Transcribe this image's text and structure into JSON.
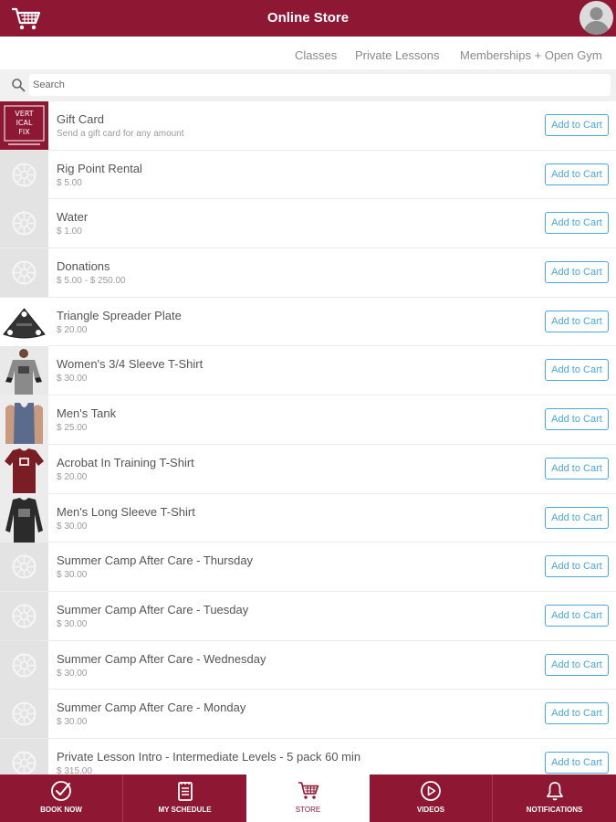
{
  "header": {
    "title": "Online Store",
    "cart_icon": "shopping-cart-icon",
    "avatar_icon": "user-avatar-icon",
    "brand_color": "#8e1734"
  },
  "tabs": [
    {
      "label": "Classes"
    },
    {
      "label": "Private Lessons"
    },
    {
      "label": "Memberships + Open Gym"
    }
  ],
  "search": {
    "placeholder": "Search"
  },
  "button_label": "Add to Cart",
  "products": [
    {
      "name": "Gift Card",
      "sub": "Send a gift card for any amount",
      "thumb": "logo",
      "logo_text": "VERT ICAL FIX"
    },
    {
      "name": "Rig Point Rental",
      "sub": "$ 5.00",
      "thumb": "placeholder"
    },
    {
      "name": "Water",
      "sub": "$ 1.00",
      "thumb": "placeholder"
    },
    {
      "name": "Donations",
      "sub": "$ 5.00 - $ 250.00",
      "thumb": "placeholder"
    },
    {
      "name": "Triangle Spreader Plate",
      "sub": "$ 20.00",
      "thumb": "plate"
    },
    {
      "name": "Women's 3/4 Sleeve T-Shirt",
      "sub": "$ 30.00",
      "thumb": "womens-shirt"
    },
    {
      "name": "Men's Tank",
      "sub": "$ 25.00",
      "thumb": "tank"
    },
    {
      "name": "Acrobat In Training T-Shirt",
      "sub": "$ 20.00",
      "thumb": "red-shirt"
    },
    {
      "name": "Men's Long Sleeve T-Shirt",
      "sub": "$ 30.00",
      "thumb": "long-sleeve"
    },
    {
      "name": "Summer Camp After Care - Thursday",
      "sub": "$ 30.00",
      "thumb": "placeholder"
    },
    {
      "name": "Summer Camp After Care - Tuesday",
      "sub": "$ 30.00",
      "thumb": "placeholder"
    },
    {
      "name": "Summer Camp After Care - Wednesday",
      "sub": "$ 30.00",
      "thumb": "placeholder"
    },
    {
      "name": "Summer Camp After Care - Monday",
      "sub": "$ 30.00",
      "thumb": "placeholder"
    },
    {
      "name": "Private Lesson Intro - Intermediate Levels - 5 pack 60 min",
      "sub": "$ 315.00",
      "thumb": "placeholder"
    }
  ],
  "bottom_nav": [
    {
      "label": "BOOK NOW",
      "icon": "check-circle-icon"
    },
    {
      "label": "MY SCHEDULE",
      "icon": "schedule-list-icon"
    },
    {
      "label": "STORE",
      "icon": "shopping-cart-icon",
      "active": true
    },
    {
      "label": "VIDEOS",
      "icon": "play-circle-icon"
    },
    {
      "label": "NOTIFICATIONS",
      "icon": "bell-icon"
    }
  ]
}
